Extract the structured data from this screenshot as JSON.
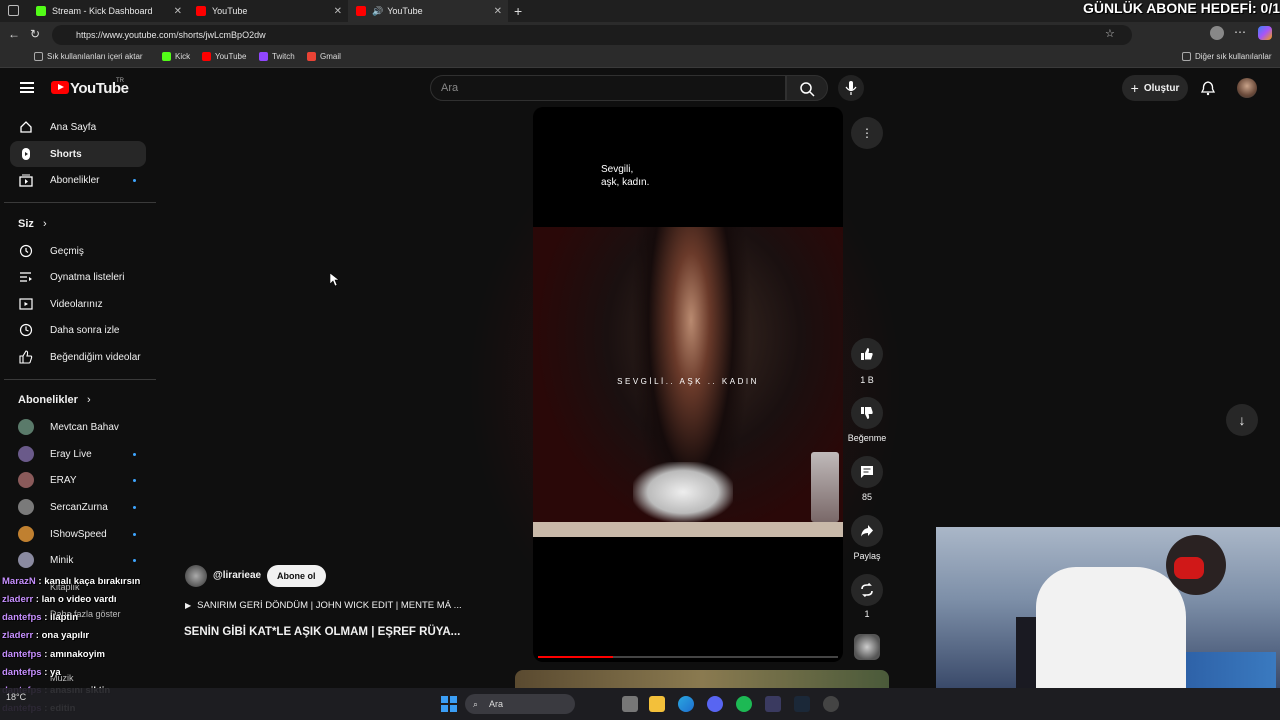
{
  "overlay": {
    "goal": "GÜNLÜK ABONE HEDEFİ: 0/1"
  },
  "browser": {
    "tabs": [
      {
        "title": "Stream - Kick Dashboard",
        "color": "#53fc18"
      },
      {
        "title": "YouTube",
        "color": "#ff0000"
      },
      {
        "title": "YouTube",
        "color": "#ff0000"
      }
    ],
    "url": "https://www.youtube.com/shorts/jwLcmBpO2dw",
    "bookmarks": [
      {
        "label": "Sık kullanılanları içeri aktar",
        "color": "#aaaaaa"
      },
      {
        "label": "Kick",
        "color": "#53fc18"
      },
      {
        "label": "YouTube",
        "color": "#ff0000"
      },
      {
        "label": "Twitch",
        "color": "#9146ff"
      },
      {
        "label": "Gmail",
        "color": "#ea4335"
      }
    ],
    "other_bookmarks": "Diğer sık kullanılanlar"
  },
  "youtube": {
    "logo": "YouTube",
    "country": "TR",
    "search_placeholder": "Ara",
    "create_label": "Oluştur",
    "sidebar": {
      "main": [
        {
          "label": "Ana Sayfa",
          "icon": "home-icon"
        },
        {
          "label": "Shorts",
          "icon": "shorts-icon"
        },
        {
          "label": "Abonelikler",
          "icon": "subscriptions-icon"
        }
      ],
      "you_title": "Siz",
      "you": [
        {
          "label": "Geçmiş",
          "icon": "history-icon"
        },
        {
          "label": "Oynatma listeleri",
          "icon": "playlist-icon"
        },
        {
          "label": "Videolarınız",
          "icon": "video-icon"
        },
        {
          "label": "Daha sonra izle",
          "icon": "clock-icon"
        },
        {
          "label": "Beğendiğim videolar",
          "icon": "thumb-up-icon"
        }
      ],
      "subs_title": "Abonelikler",
      "subs": [
        {
          "label": "Mevtcan Bahav",
          "color": "#5a7a6a"
        },
        {
          "label": "Eray Live",
          "color": "#6a5a8a"
        },
        {
          "label": "ERAY",
          "color": "#8a5a5a"
        },
        {
          "label": "SercanZurna",
          "color": "#7a7a7a"
        },
        {
          "label": "IShowSpeed",
          "color": "#c08030"
        },
        {
          "label": "Minik",
          "color": "#8a8aa0"
        }
      ],
      "partial": [
        "Kitaplık",
        "Daha fazla göster",
        "Müzik"
      ]
    },
    "short": {
      "overlay_text": "Sevgili,\naşk, kadın.",
      "caption_text": "SEVGİLİ.. AŞK .. KADIN",
      "channel": "@lirarieae",
      "subscribe": "Abone ol",
      "music": "SANIRIM GERİ DÖNDÜM | JOHN WICK EDIT | MENTE MÁ ...",
      "title": "SENİN GİBİ KAT*LE AŞIK OLMAM | EŞREF RÜYA...",
      "progress_percent": 25
    },
    "actions": {
      "likes": "1 B",
      "dislike": "Beğenme",
      "comments": "85",
      "share": "Paylaş",
      "remix": "1"
    }
  },
  "chat": [
    {
      "user": "MarazN",
      "msg": " : kanalı kaça bırakırsın"
    },
    {
      "user": "zladerr",
      "msg": " : lan o video vardı"
    },
    {
      "user": "dantefps",
      "msg": " : ilaptin"
    },
    {
      "user": "zladerr",
      "msg": " : ona yapılır"
    },
    {
      "user": "dantefps",
      "msg": " : amınakoyim"
    },
    {
      "user": "dantefps",
      "msg": " : ya"
    },
    {
      "user": "dantefps",
      "msg": " : anasını siktin"
    },
    {
      "user": "dantefps",
      "msg": " : editin"
    }
  ],
  "taskbar": {
    "search": "Ara",
    "weather": "18°C"
  }
}
